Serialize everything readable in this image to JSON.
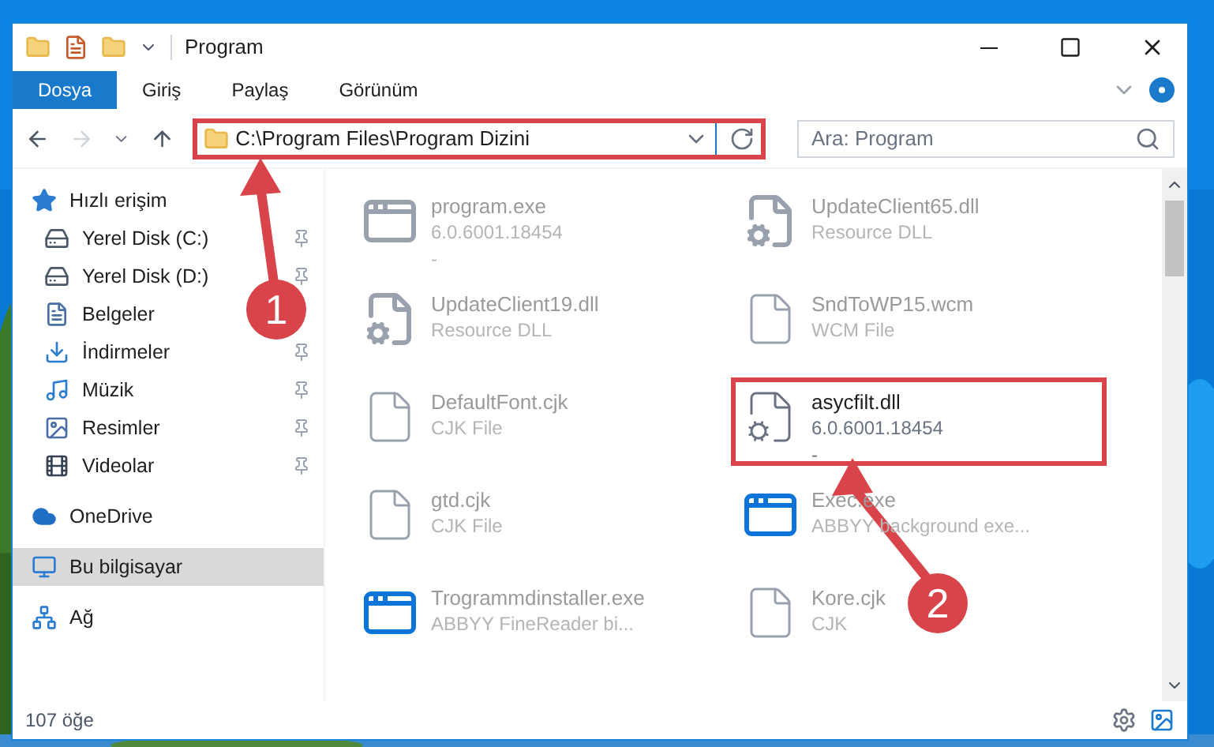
{
  "window": {
    "title": "Program"
  },
  "ribbon_tabs": [
    {
      "label": "Dosya",
      "selected": true
    },
    {
      "label": "Giriş",
      "selected": false
    },
    {
      "label": "Paylaş",
      "selected": false
    },
    {
      "label": "Görünüm",
      "selected": false
    }
  ],
  "address_bar": {
    "path": "C:\\Program Files\\Program Dizini",
    "highlighted": true
  },
  "search": {
    "placeholder": "Ara: Program"
  },
  "sidebar": {
    "items": [
      {
        "label": "Hızlı erişim",
        "kind": "star",
        "pinned": false,
        "selected": false,
        "children": [
          {
            "label": "Yerel Disk (C:)",
            "kind": "drive",
            "pinned": true,
            "selected": false
          },
          {
            "label": "Yerel Disk (D:)",
            "kind": "drive",
            "pinned": true,
            "selected": false
          },
          {
            "label": "Belgeler",
            "kind": "docs",
            "pinned": false,
            "selected": false
          },
          {
            "label": "İndirmeler",
            "kind": "download",
            "pinned": true,
            "selected": false
          },
          {
            "label": "Müzik",
            "kind": "music",
            "pinned": true,
            "selected": false
          },
          {
            "label": "Resimler",
            "kind": "pictures",
            "pinned": true,
            "selected": false
          },
          {
            "label": "Videolar",
            "kind": "video",
            "pinned": true,
            "selected": false
          }
        ]
      },
      {
        "label": "OneDrive",
        "kind": "cloud",
        "pinned": false,
        "selected": false
      },
      {
        "label": "Bu bilgisayar",
        "kind": "pc",
        "pinned": false,
        "selected": true
      },
      {
        "label": "Ağ",
        "kind": "network",
        "pinned": false,
        "selected": false
      }
    ]
  },
  "files": [
    {
      "name": "program.exe",
      "detail": "6.0.6001.18454",
      "extra": "-",
      "kind": "app",
      "dimmed": true,
      "highlighted": false
    },
    {
      "name": "UpdateClient65.dll",
      "detail": "Resource DLL",
      "kind": "dll",
      "dimmed": true,
      "highlighted": false
    },
    {
      "name": "UpdateClient19.dll",
      "detail": "Resource DLL",
      "kind": "dll",
      "dimmed": true,
      "highlighted": false
    },
    {
      "name": "SndToWP15.wcm",
      "detail": "WCM File",
      "kind": "blank",
      "dimmed": true,
      "highlighted": false
    },
    {
      "name": "DefaultFont.cjk",
      "detail": "CJK File",
      "kind": "blank",
      "dimmed": true,
      "highlighted": false
    },
    {
      "name": "asycfilt.dll",
      "detail": "6.0.6001.18454",
      "extra": "-",
      "kind": "gear",
      "dimmed": false,
      "highlighted": true
    },
    {
      "name": "gtd.cjk",
      "detail": "CJK File",
      "kind": "blank",
      "dimmed": true,
      "highlighted": false
    },
    {
      "name": "Exec.exe",
      "detail": "ABBYY background exe...",
      "kind": "window",
      "dimmed": true,
      "highlighted": false
    },
    {
      "name": "Trogrammdinstaller.exe",
      "detail": "ABBYY FineReader bi...",
      "kind": "window",
      "dimmed": true,
      "highlighted": false
    },
    {
      "name": "Kore.cjk",
      "detail": "CJK",
      "kind": "blank",
      "dimmed": true,
      "highlighted": false
    }
  ],
  "status_bar": {
    "count": "107 öğe"
  },
  "annotations": [
    {
      "number": "1"
    },
    {
      "number": "2"
    }
  ]
}
